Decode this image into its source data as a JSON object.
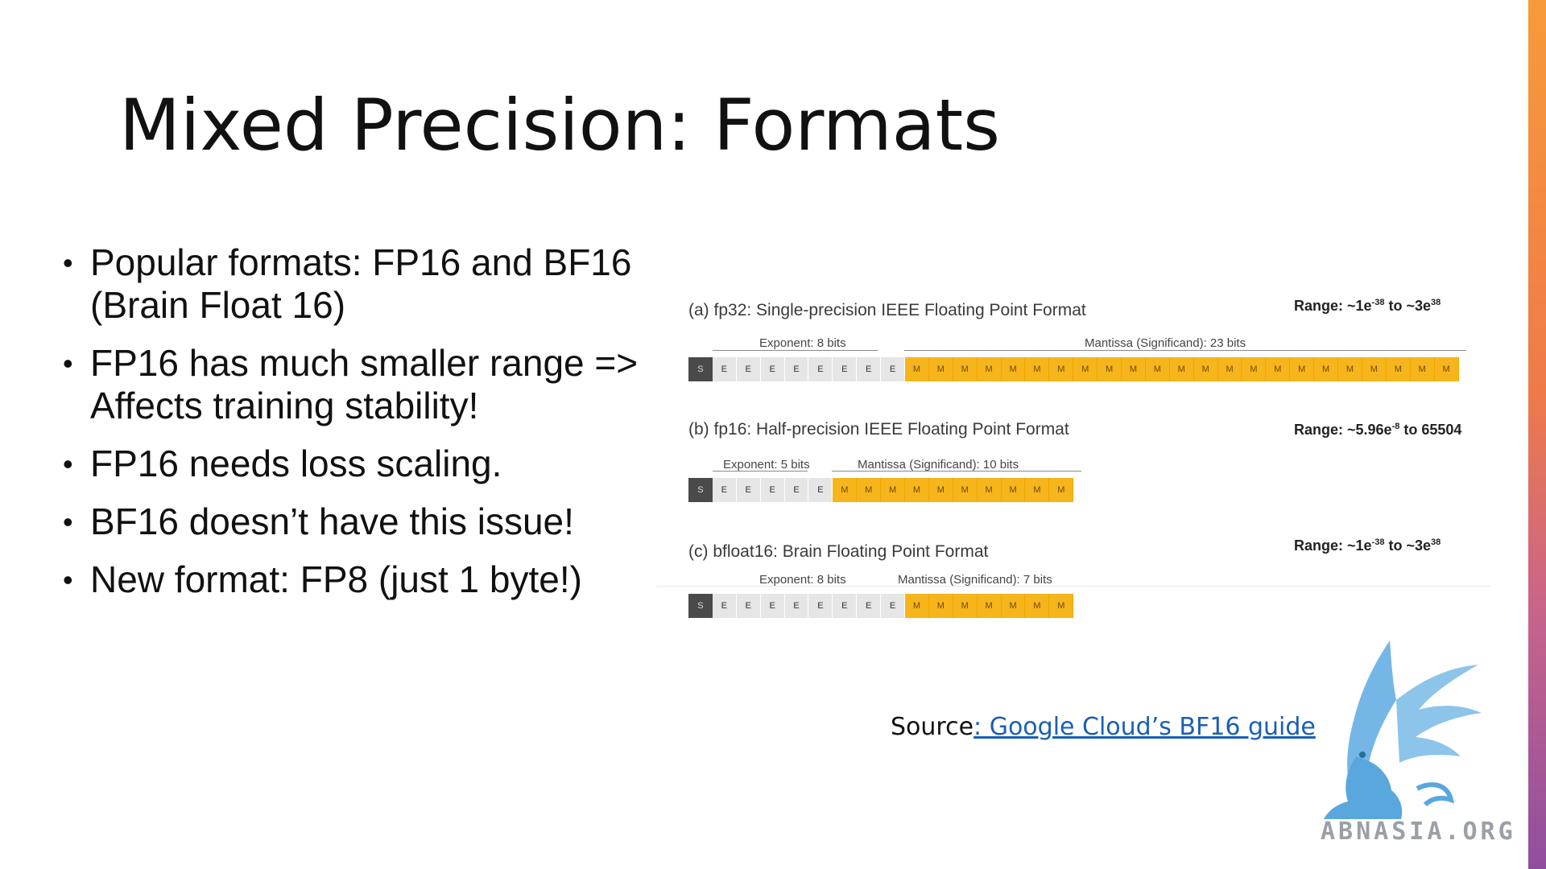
{
  "title": "Mixed Precision: Formats",
  "bullets": [
    "Popular formats: FP16 and BF16 (Brain Float 16)",
    "FP16 has much smaller range => Affects training stability!",
    "FP16 needs loss scaling.",
    "BF16 doesn’t have this issue!",
    "New format: FP8 (just 1 byte!)"
  ],
  "figure": {
    "formats": [
      {
        "title": "(a) fp32: Single-precision IEEE Floating Point Format",
        "range_prefix": "Range: ~1e",
        "range_exp1": "-38",
        "range_mid": " to ~3e",
        "range_exp2": "38",
        "exponent_label": "Exponent: 8 bits",
        "mantissa_label": "Mantissa (Significand):  23 bits",
        "exponent_bits": 8,
        "mantissa_bits": 23
      },
      {
        "title": "(b) fp16: Half-precision IEEE Floating Point Format",
        "range_prefix": "Range: ~5.96e",
        "range_exp1": "-8",
        "range_mid": " to 65504",
        "range_exp2": "",
        "exponent_label": "Exponent: 5 bits",
        "mantissa_label": "Mantissa (Significand):  10 bits",
        "exponent_bits": 5,
        "mantissa_bits": 10
      },
      {
        "title": "(c) bfloat16: Brain Floating Point Format",
        "range_prefix": "Range: ~1e",
        "range_exp1": "-38",
        "range_mid": " to ~3e",
        "range_exp2": "38",
        "exponent_label": "Exponent: 8 bits",
        "mantissa_label": "Mantissa (Significand):  7 bits",
        "exponent_bits": 8,
        "mantissa_bits": 7
      }
    ],
    "bit_letters": {
      "sign": "S",
      "exponent": "E",
      "mantissa": "M"
    }
  },
  "source": {
    "prefix": "Source",
    "link_text": ": Google Cloud’s BF16 guide"
  },
  "watermark": {
    "text": "ABNASIA.ORG"
  },
  "colors": {
    "mantissa": "#f7b51c",
    "exponent": "#e6e6e6",
    "sign": "#4a4a4a",
    "link": "#1a5fb4",
    "watermark": "#74b7e6"
  }
}
